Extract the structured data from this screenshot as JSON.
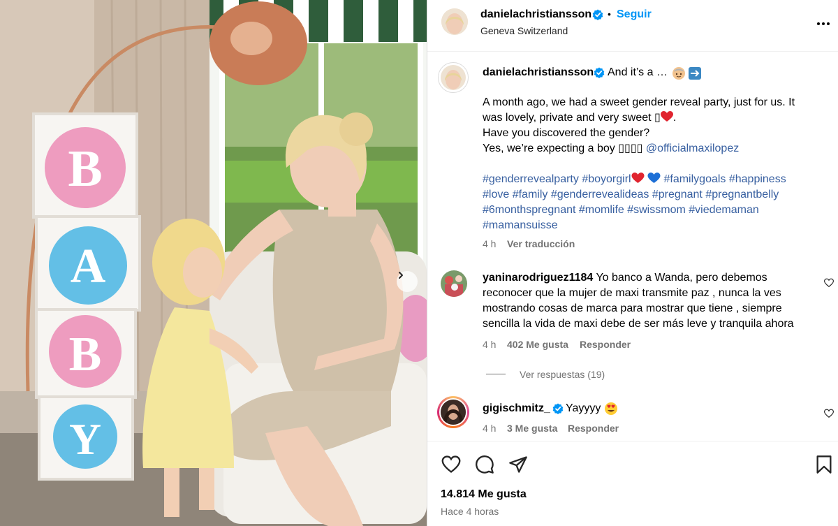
{
  "header": {
    "username": "danielachristiansson",
    "separator": "•",
    "follow_label": "Seguir",
    "location": "Geneva Switzerland",
    "more_icon": "more-horizontal-icon"
  },
  "caption": {
    "username": "danielachristiansson",
    "headline": "And it’s a …",
    "headline_emojis": [
      "baby-face-emoji",
      "right-arrow-button-emoji"
    ],
    "line1": "A month ago, we had a sweet gender reveal party, just for us. It",
    "line2": "was lovely, private and very sweet ",
    "line2_end": ".",
    "line2_glyph": "▯",
    "line3": "Have you discovered the gender?",
    "line4": "Yes, we’re expecting a boy ",
    "line4_glyphs": "▯▯▯▯",
    "mention": "@officialmaxilopez",
    "hashtags_line1": "#genderrevealparty #boyorgirl",
    "hashtags_line1b": "#familygoals #happiness",
    "hashtags_line2": "#love #family #genderrevealideas #pregnant #pregnantbelly",
    "hashtags_line3": "#6monthspregnant #momlife #swissmom #viedemaman",
    "hashtags_line4": "#mamansuisse",
    "time": "4 h",
    "translate": "Ver traducción"
  },
  "comments": [
    {
      "username": "yaninarodriguez1184",
      "line1": "Yo banco a Wanda, pero debemos",
      "line2": "reconocer que la mujer de maxi transmite paz , nunca la ves",
      "line3": "mostrando cosas de marca para mostrar que tiene , siempre",
      "line4": "sencilla la vida de maxi debe de ser más leve y tranquila ahora",
      "time": "4 h",
      "likes": "402 Me gusta",
      "reply": "Responder",
      "replies": "Ver respuestas (19)"
    },
    {
      "username": "gigischmitz_",
      "text": "Yayyyy",
      "time": "4 h",
      "likes": "3 Me gusta",
      "reply": "Responder"
    }
  ],
  "footer": {
    "likes": "14.814 Me gusta",
    "posted": "Hace 4 horas"
  },
  "colors": {
    "verified": "#0095f6",
    "follow": "#0095f6",
    "link": "#375fa0",
    "muted": "#737373"
  }
}
